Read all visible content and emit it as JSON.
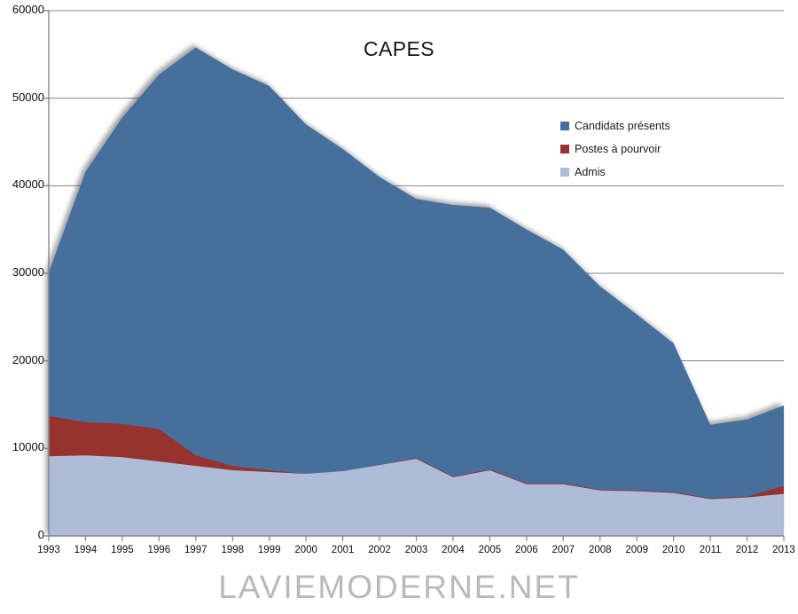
{
  "chart_data": {
    "type": "area",
    "title": "CAPES",
    "xlabel": "",
    "ylabel": "",
    "stacked": false,
    "grid": true,
    "legend_position": "inside-right",
    "xlim": [
      1993,
      2013
    ],
    "ylim": [
      0,
      60000
    ],
    "ytick_step": 10000,
    "yticks": [
      "0",
      "10000",
      "20000",
      "30000",
      "40000",
      "50000",
      "60000"
    ],
    "categories": [
      1993,
      1994,
      1995,
      1996,
      1997,
      1998,
      1999,
      2000,
      2001,
      2002,
      2003,
      2004,
      2005,
      2006,
      2007,
      2008,
      2009,
      2010,
      2011,
      2012,
      2013
    ],
    "tick_labels": [
      "1993",
      "1994",
      "1995",
      "1996",
      "1997",
      "1998",
      "1999",
      "2000",
      "2001",
      "2002",
      "2003",
      "2004",
      "2005",
      "2006",
      "2007",
      "2008",
      "2009",
      "2010",
      "2011",
      "2012",
      "2013"
    ],
    "series": [
      {
        "name": "Candidats présents",
        "color": "#44709E",
        "values": [
          30100,
          41600,
          47800,
          52700,
          55800,
          53300,
          51400,
          47000,
          44200,
          41000,
          38500,
          37800,
          37500,
          35000,
          32700,
          28500,
          25300,
          22000,
          12700,
          13300,
          14900
        ]
      },
      {
        "name": "Postes à pourvoir",
        "color": "#98322F",
        "values": [
          13700,
          13000,
          12800,
          12200,
          9200,
          8000,
          7500,
          7100,
          7400,
          8100,
          8900,
          6800,
          7600,
          6000,
          6000,
          5300,
          5200,
          5000,
          4300,
          4500,
          5700
        ]
      },
      {
        "name": "Admis",
        "color": "#AEBCD9",
        "values": [
          9100,
          9200,
          9000,
          8500,
          8000,
          7500,
          7300,
          7100,
          7400,
          8100,
          8800,
          6700,
          7500,
          5900,
          5900,
          5200,
          5100,
          4900,
          4200,
          4400,
          4800
        ]
      }
    ]
  },
  "watermark": {
    "text": "LAVIEMODERNE.NET"
  },
  "colors": {
    "candidats": "#44709E",
    "postes": "#98322F",
    "admis": "#AEBCD9",
    "grid": "#868686",
    "axis": "#868686",
    "text": "#0d0d0d"
  }
}
